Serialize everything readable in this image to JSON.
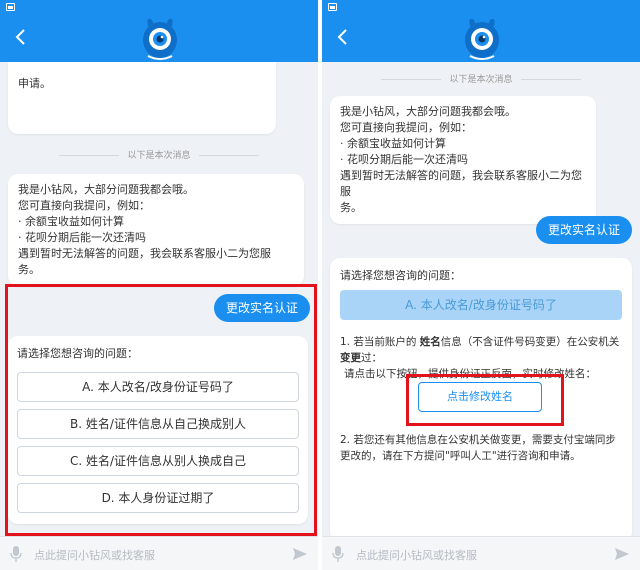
{
  "colors": {
    "accent": "#1a8ff0",
    "highlight": "#e3131b",
    "selected_bg": "#a9d4f7"
  },
  "header": {
    "back_icon": "chevron-left-icon",
    "logo": "bot-mascot-logo"
  },
  "left": {
    "prev_tail": "申请。",
    "separator": "以下是本次消息",
    "greeting": {
      "line1": "我是小钻风，大部分问题我都会哦。",
      "line2": "您可直接向我提问，例如：",
      "line3": "· 余额宝收益如何计算",
      "line4": "· 花呗分期后能一次还清吗",
      "line5": "遇到暂时无法解答的问题，我会联系客服小二为您服",
      "line6": "务。"
    },
    "user_msg": "更改实名认证",
    "prompt": "请选择您想咨询的问题：",
    "options": [
      "A. 本人改名/改身份证号码了",
      "B. 姓名/证件信息从自己换成别人",
      "C. 姓名/证件信息从别人换成自己",
      "D. 本人身份证过期了"
    ]
  },
  "right": {
    "separator": "以下是本次消息",
    "greeting": {
      "line1": "我是小钻风，大部分问题我都会哦。",
      "line2": "您可直接向我提问，例如：",
      "line3": "· 余额宝收益如何计算",
      "line4": "· 花呗分期后能一次还清吗",
      "line5": "遇到暂时无法解答的问题，我会联系客服小二为您服",
      "line6": "务。"
    },
    "user_msg": "更改实名认证",
    "prompt": "请选择您想咨询的问题：",
    "selected_option": "A. 本人改名/改身份证号码了",
    "info1_prefix": "1. 若当前账户的 ",
    "info1_bold1": "姓名",
    "info1_mid": "信息（不含证件号码变更）在公安机关",
    "info1_bold2": "变更",
    "info1_suffix": "过：",
    "info1_line3": "请点击以下按钮，提供身份证正反面，实时修改姓名：",
    "action_button": "点击修改姓名",
    "info2_line1": "2. 若您还有其他信息在公安机关做变更，需要支付宝端同步",
    "info2_line2": "更改的，请在下方提问\"呼叫人工\"进行咨询和申请。"
  },
  "input": {
    "placeholder": "点此提问小钻风或找客服",
    "mic_icon": "microphone-icon",
    "send_icon": "send-icon"
  }
}
